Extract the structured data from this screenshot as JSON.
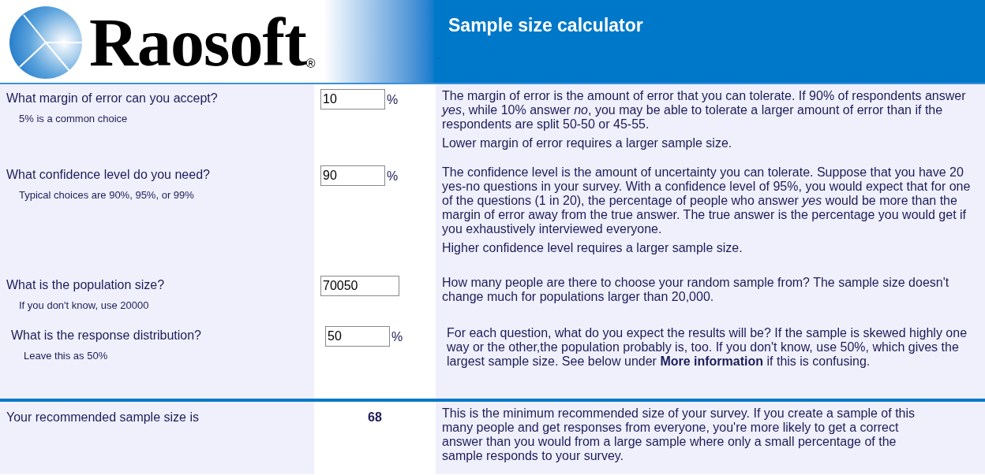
{
  "header": {
    "logo_text": "Raosoft",
    "registered_mark": "®",
    "title": "Sample size calculator",
    "mark": "."
  },
  "questions": [
    {
      "question": "What margin of error can you accept?",
      "hint": "5% is a common choice",
      "value": "10",
      "unit": "%",
      "description": [
        "The margin of error is the amount of error that you can tolerate. If 90% of respondents answer *yes*, while 10% answer *no*, you may be able to tolerate a larger amount of error than if the respondents are split 50-50 or 45-55.",
        "Lower margin of error requires a larger sample size."
      ]
    },
    {
      "question": "What confidence level do you need?",
      "hint": "Typical choices are 90%, 95%, or 99%",
      "value": "90",
      "unit": "%",
      "description": [
        "The confidence level is the amount of uncertainty you can tolerate. Suppose that you have 20 yes-no questions in your survey. With a confidence level of 95%, you would expect that for one of the questions (1 in 20), the percentage of people who answer *yes* would be more than the margin of error away from the true answer. The true answer is the percentage you would get if you exhaustively interviewed everyone.",
        "Higher confidence level requires a larger sample size."
      ]
    },
    {
      "question": "What is the population size?",
      "hint": "If you don't know, use 20000",
      "value": "70050",
      "description": [
        "How many people are there to choose your random sample from? The sample size doesn't change much for populations larger than 20,000."
      ]
    },
    {
      "question": "What is the response distribution?",
      "hint": "Leave this as 50%",
      "value": "50",
      "unit": "%",
      "description": [
        "For each question, what do you expect the results will be? If the sample is skewed highly one way or the other,the population probably is, too. If you don't know, use 50%, which gives the largest sample size. See below under **More information** if this is confusing."
      ]
    }
  ],
  "result": {
    "label": "Your recommended sample size is",
    "value": "68",
    "description": "This is the minimum recommended size of your survey. If you create a sample of this many people and get responses from everyone, you're more likely to get a correct answer than you would from a large sample where only a small percentage of the sample responds to your survey."
  }
}
